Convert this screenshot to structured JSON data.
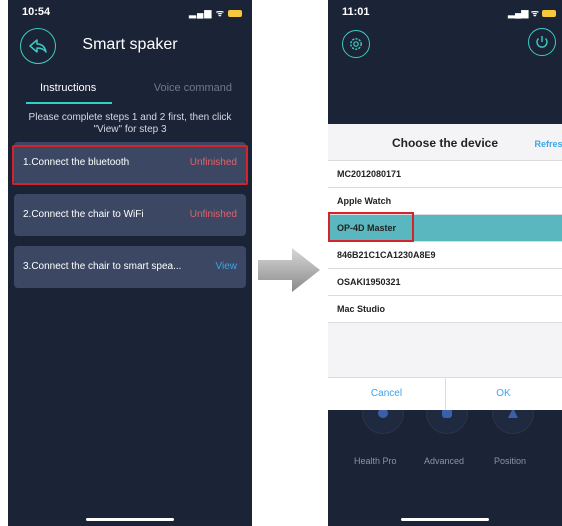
{
  "left": {
    "status": {
      "time": "10:54"
    },
    "title": "Smart spaker",
    "tabs": {
      "instructions": "Instructions",
      "voice": "Voice command"
    },
    "hint": "Please complete steps 1 and 2 first, then click \"View\" for step 3",
    "steps": [
      {
        "label": "1.Connect the bluetooth",
        "status": "Unfinished"
      },
      {
        "label": "2.Connect the chair to WiFi",
        "status": "Unfinished"
      },
      {
        "label": "3.Connect the chair to smart spea...",
        "status": "View"
      }
    ]
  },
  "right": {
    "status": {
      "time": "11:01"
    },
    "dialog": {
      "title": "Choose the device",
      "refresh": "Refresh",
      "devices": [
        "MC2012080171",
        "Apple Watch",
        "OP-4D Master",
        "846B21C1CA1230A8E9",
        "OSAKI1950321",
        "Mac Studio"
      ],
      "selected_index": 2,
      "cancel": "Cancel",
      "ok": "OK"
    },
    "modes": [
      "Health Pro",
      "Advanced",
      "Position"
    ]
  },
  "colors": {
    "background": "#1b2336",
    "accent": "#2fd0c7",
    "unfinished": "#e0616c",
    "link": "#3ea4e6",
    "highlight": "#d4242b"
  }
}
